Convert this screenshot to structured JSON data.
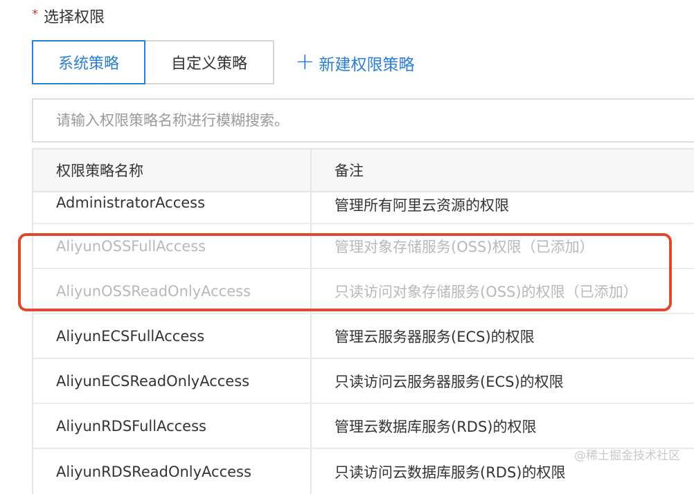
{
  "form": {
    "required_mark": "*",
    "label": "选择权限"
  },
  "tabs": [
    {
      "label": "系统策略",
      "active": true
    },
    {
      "label": "自定义策略",
      "active": false
    }
  ],
  "new_policy": {
    "icon": "plus-icon",
    "label": "新建权限策略"
  },
  "search": {
    "placeholder": "请输入权限策略名称进行模糊搜索。",
    "value": ""
  },
  "table": {
    "columns": [
      "权限策略名称",
      "备注"
    ],
    "rows": [
      {
        "name": "AdministratorAccess",
        "note": "管理所有阿里云资源的权限",
        "disabled": false
      },
      {
        "name": "AliyunOSSFullAccess",
        "note": "管理对象存储服务(OSS)权限（已添加）",
        "disabled": true
      },
      {
        "name": "AliyunOSSReadOnlyAccess",
        "note": "只读访问对象存储服务(OSS)的权限（已添加）",
        "disabled": true
      },
      {
        "name": "AliyunECSFullAccess",
        "note": "管理云服务器服务(ECS)的权限",
        "disabled": false
      },
      {
        "name": "AliyunECSReadOnlyAccess",
        "note": "只读访问云服务器服务(ECS)的权限",
        "disabled": false
      },
      {
        "name": "AliyunRDSFullAccess",
        "note": "管理云数据库服务(RDS)的权限",
        "disabled": false
      },
      {
        "name": "AliyunRDSReadOnlyAccess",
        "note": "只读访问云数据库服务(RDS)的权限",
        "disabled": false
      }
    ]
  },
  "watermark": "@稀土掘金技术社区",
  "colors": {
    "accent": "#2a7fd4",
    "required": "#e03c2c",
    "highlight": "#e0482c",
    "disabled_text": "#b8b8b8"
  }
}
